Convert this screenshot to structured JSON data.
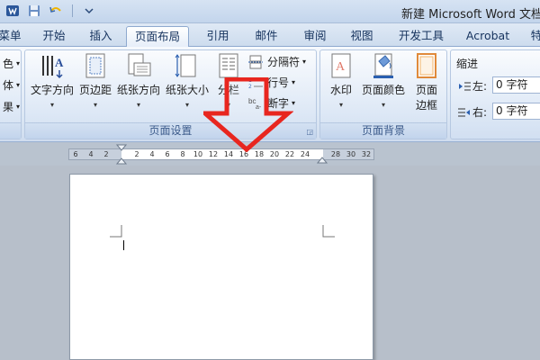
{
  "titlebar": {
    "title": "新建 Microsoft Word 文档",
    "qat_icons": [
      "word-logo-icon",
      "save-icon",
      "undo-icon",
      "customize-qat-icon"
    ]
  },
  "tabs": [
    {
      "label": "菜单",
      "active": false
    },
    {
      "label": "开始",
      "active": false
    },
    {
      "label": "插入",
      "active": false
    },
    {
      "label": "页面布局",
      "active": true
    },
    {
      "label": "引用",
      "active": false
    },
    {
      "label": "邮件",
      "active": false
    },
    {
      "label": "审阅",
      "active": false
    },
    {
      "label": "视图",
      "active": false
    },
    {
      "label": "开发工具",
      "active": false
    },
    {
      "label": "Acrobat",
      "active": false
    },
    {
      "label": "特",
      "active": false
    }
  ],
  "ribbon": {
    "themes_partial": [
      "色",
      "体",
      "果"
    ],
    "page_setup": {
      "label": "页面设置",
      "text_direction": "文字方向",
      "margins": "页边距",
      "orientation": "纸张方向",
      "size": "纸张大小",
      "columns": "分栏",
      "breaks": "分隔符",
      "line_numbers": "行号",
      "hyphenation": "断字"
    },
    "page_background": {
      "label": "页面背景",
      "watermark": "水印",
      "page_color": "页面颜色",
      "page_borders_line1": "页面",
      "page_borders_line2": "边框"
    },
    "paragraph": {
      "indent_title": "缩进",
      "left_label": "左:",
      "left_value": "0 字符",
      "right_label": "右:",
      "right_value": "0 字符"
    }
  },
  "ruler": {
    "ticks": [
      "6",
      "4",
      "2",
      "2",
      "4",
      "6",
      "8",
      "10",
      "12",
      "14",
      "16",
      "18",
      "20",
      "22",
      "24",
      "28",
      "30",
      "32"
    ]
  },
  "annotation": {
    "type": "red-down-arrow",
    "color": "#e8261f"
  },
  "colors": {
    "accent": "#e8261f",
    "ribbon_text": "#15325d"
  }
}
